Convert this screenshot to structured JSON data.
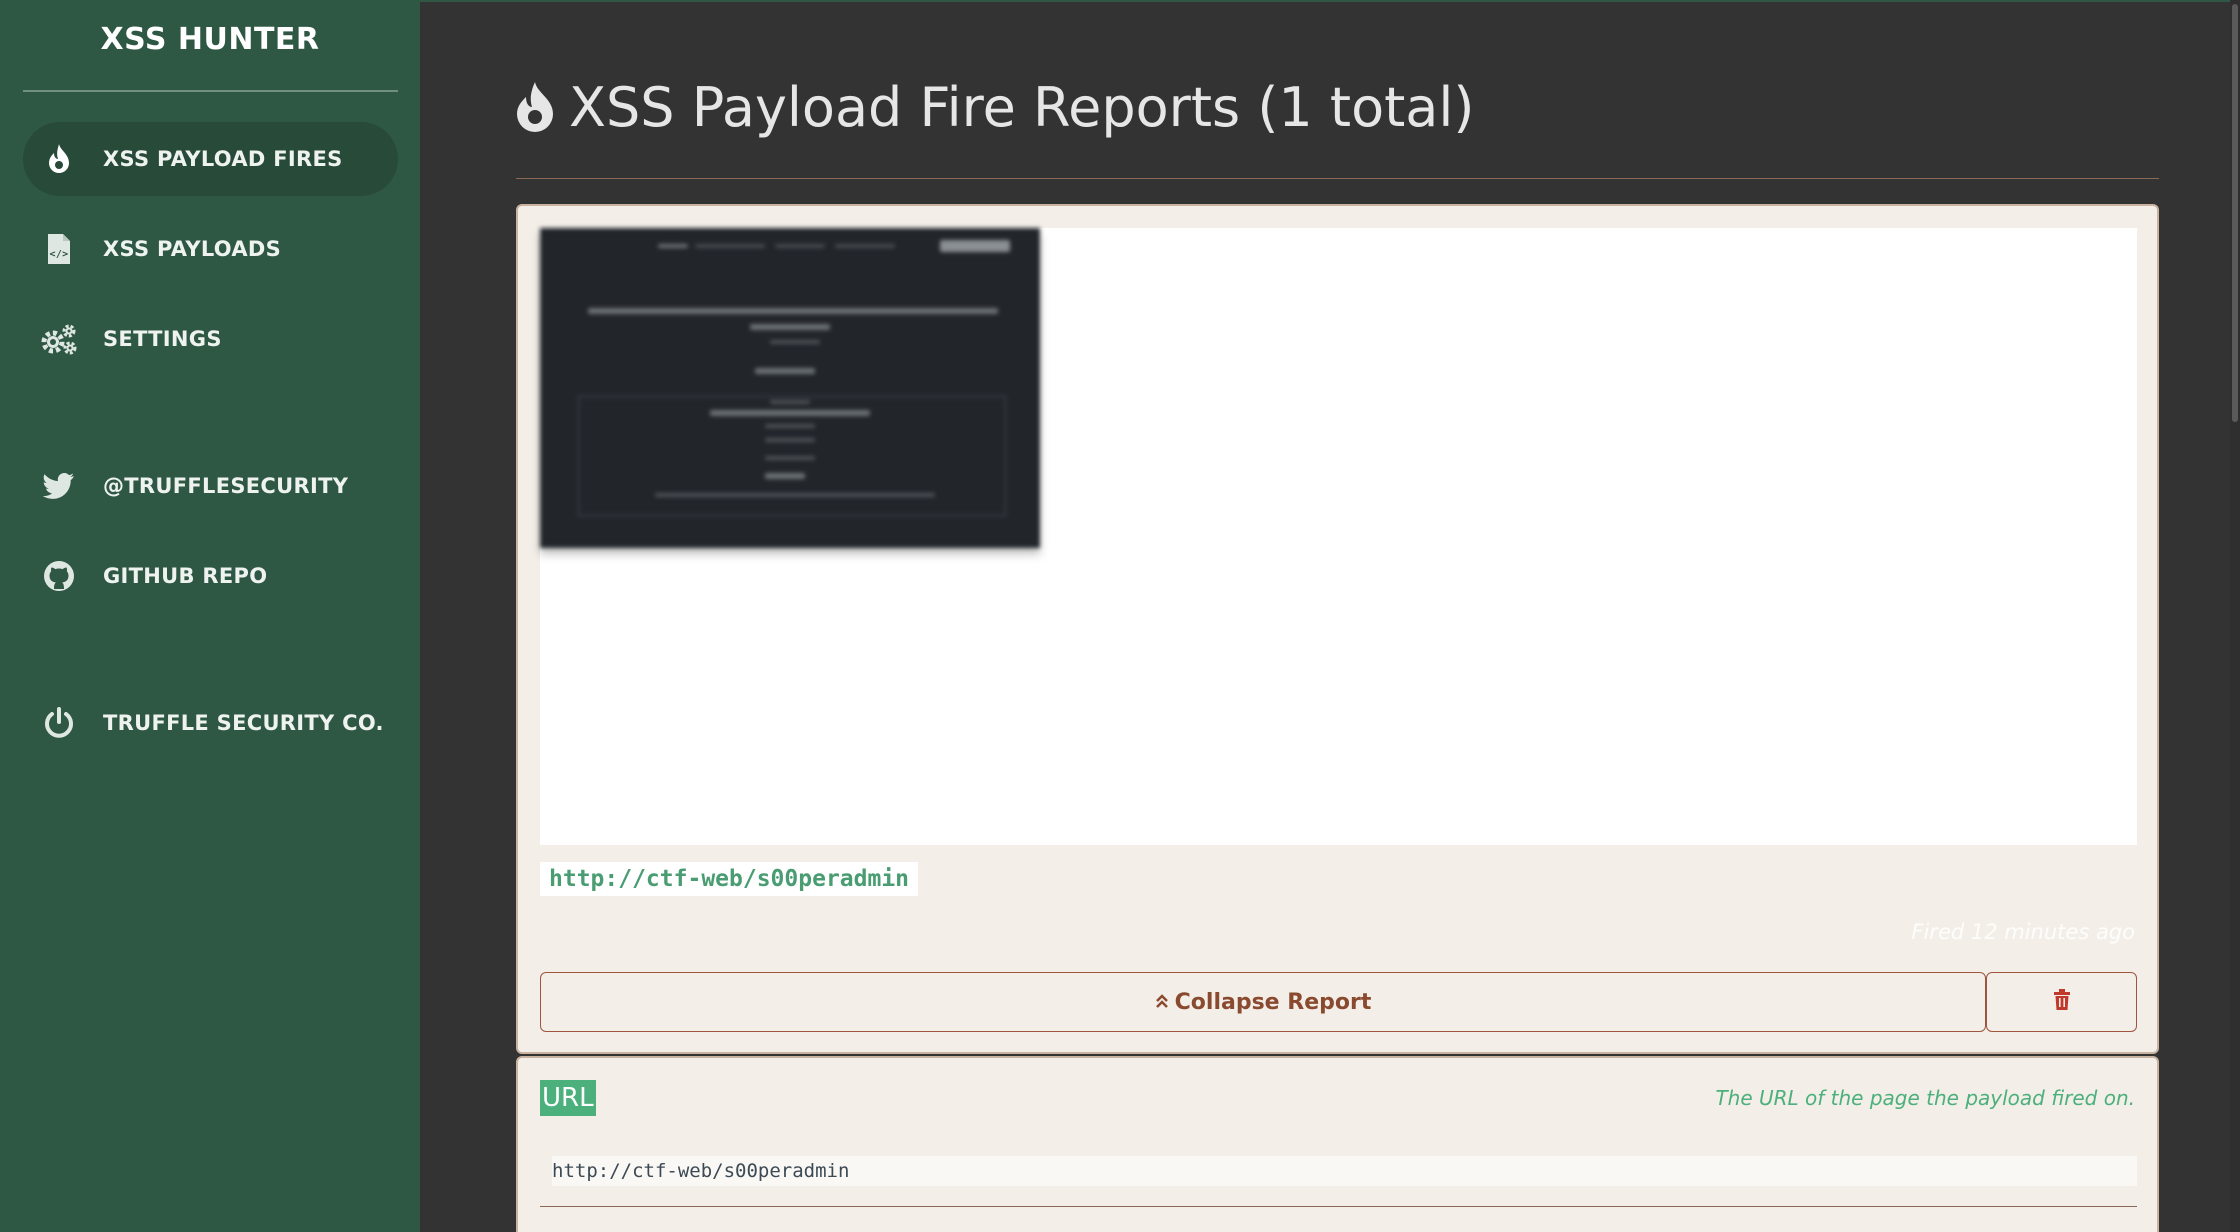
{
  "sidebar": {
    "brand": "XSS HUNTER",
    "items": [
      {
        "label": "XSS PAYLOAD FIRES",
        "icon": "flame-icon",
        "active": true
      },
      {
        "label": "XSS PAYLOADS",
        "icon": "code-file-icon",
        "active": false
      },
      {
        "label": "SETTINGS",
        "icon": "gears-icon",
        "active": false
      },
      {
        "label": "@TRUFFLESECURITY",
        "icon": "twitter-icon",
        "active": false
      },
      {
        "label": "GITHUB REPO",
        "icon": "github-icon",
        "active": false
      },
      {
        "label": "TRUFFLE SECURITY CO.",
        "icon": "power-icon",
        "active": false
      }
    ]
  },
  "main": {
    "title": "XSS Payload Fire Reports (1 total)",
    "report": {
      "url": "http://ctf-web/s00peradmin",
      "fired": "Fired 12 minutes ago",
      "collapse_label": "Collapse Report"
    },
    "fields": [
      {
        "label": "URL",
        "description": "The URL of the page the payload fired on.",
        "value": "http://ctf-web/s00peradmin"
      }
    ]
  },
  "colors": {
    "sidebar_bg": "#2e5744",
    "sidebar_active": "#274a39",
    "main_bg": "#333333",
    "card_bg": "#f3eee8",
    "accent_green": "#4cb07c",
    "danger": "#c0392b",
    "button_text": "#8a4a2f"
  }
}
